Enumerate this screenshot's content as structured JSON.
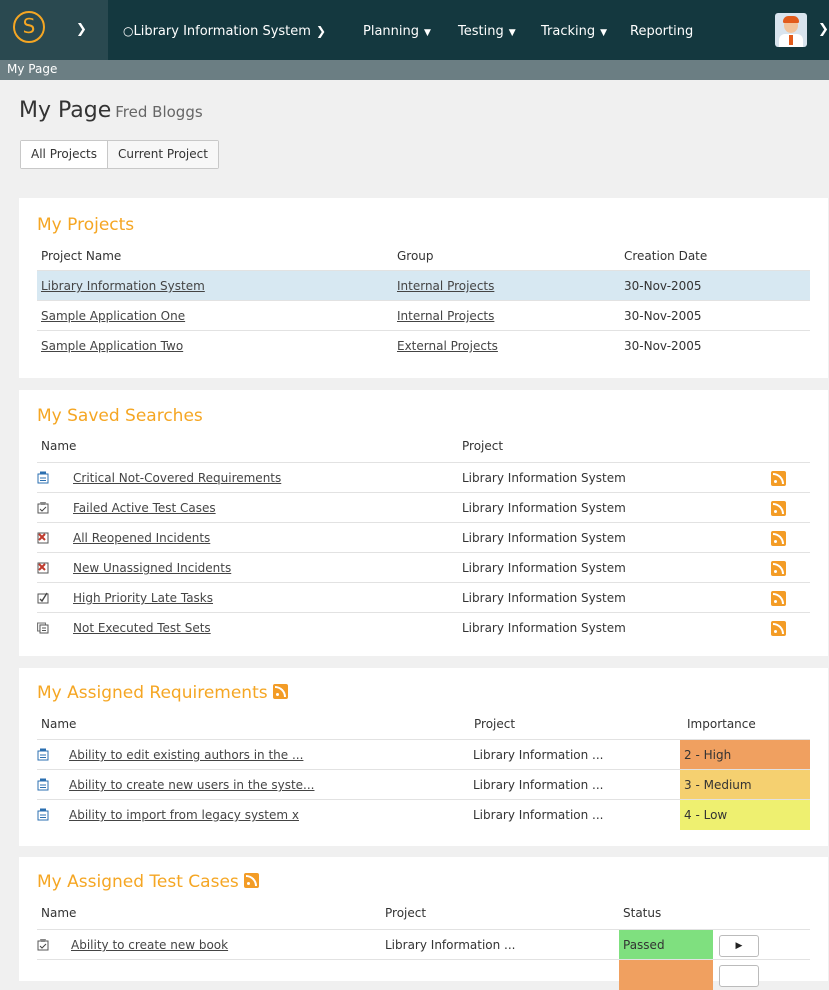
{
  "nav": {
    "project": "Library Information System",
    "items": [
      {
        "label": "Planning"
      },
      {
        "label": "Testing"
      },
      {
        "label": "Tracking"
      },
      {
        "label": "Reporting"
      }
    ]
  },
  "breadcrumb": "My Page",
  "page": {
    "title": "My Page",
    "user": "Fred Bloggs",
    "toggles": [
      "All Projects",
      "Current Project"
    ]
  },
  "projects": {
    "title": "My Projects",
    "columns": [
      "Project Name",
      "Group",
      "Creation Date"
    ],
    "rows": [
      {
        "name": "Library Information System",
        "group": "Internal Projects",
        "date": "30-Nov-2005"
      },
      {
        "name": "Sample Application One",
        "group": "Internal Projects",
        "date": "30-Nov-2005"
      },
      {
        "name": "Sample Application Two",
        "group": "External Projects",
        "date": "30-Nov-2005"
      }
    ]
  },
  "searches": {
    "title": "My Saved Searches",
    "columns": [
      "Name",
      "Project"
    ],
    "rows": [
      {
        "icon": "requirement-icon",
        "name": "Critical Not-Covered Requirements",
        "project": "Library Information System"
      },
      {
        "icon": "test-case-icon",
        "name": "Failed Active Test Cases",
        "project": "Library Information System"
      },
      {
        "icon": "incident-icon",
        "name": "All Reopened Incidents",
        "project": "Library Information System"
      },
      {
        "icon": "incident-icon",
        "name": "New Unassigned Incidents",
        "project": "Library Information System"
      },
      {
        "icon": "task-icon",
        "name": "High Priority Late Tasks",
        "project": "Library Information System"
      },
      {
        "icon": "test-set-icon",
        "name": "Not Executed Test Sets",
        "project": "Library Information System"
      }
    ]
  },
  "requirements": {
    "title": "My Assigned Requirements",
    "columns": [
      "Name",
      "Project",
      "Importance"
    ],
    "rows": [
      {
        "name": "Ability to edit existing authors in the ...",
        "project": "Library Information ...",
        "importance": "2 - High",
        "color": "#f0a060"
      },
      {
        "name": "Ability to create new users in the syste...",
        "project": "Library Information ...",
        "importance": "3 - Medium",
        "color": "#f5d070"
      },
      {
        "name": "Ability to import from legacy system x",
        "project": "Library Information ...",
        "importance": "4 - Low",
        "color": "#eef070"
      }
    ]
  },
  "testcases": {
    "title": "My Assigned Test Cases",
    "columns": [
      "Name",
      "Project",
      "Status"
    ],
    "rows": [
      {
        "name": "Ability to create new book",
        "project": "Library Information ...",
        "status": "Passed",
        "color": "#7fe07f"
      },
      {
        "name": "",
        "project": "",
        "status": "",
        "color": "#f0a060"
      }
    ]
  }
}
